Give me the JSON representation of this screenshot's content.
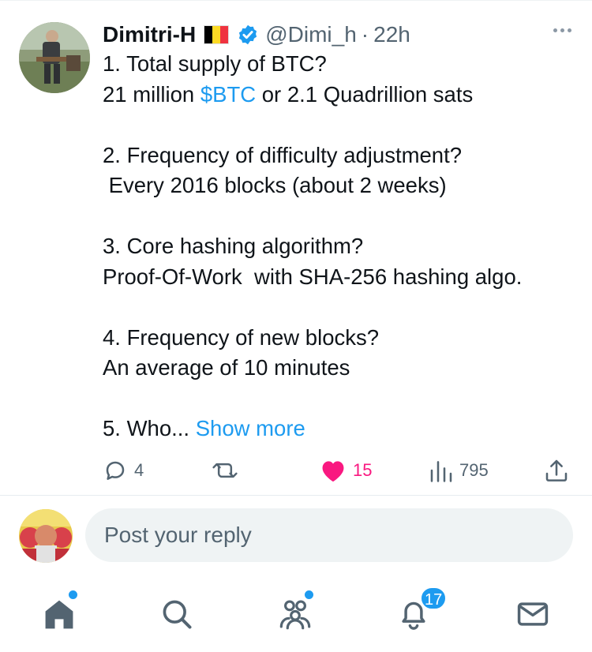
{
  "tweet": {
    "display_name": "Dimitri-H",
    "handle": "@Dimi_h",
    "separator": "·",
    "time": "22h",
    "flag_icon": "belgium-flag",
    "verified_icon": "verified-badge-icon",
    "lines": {
      "q1": "1. Total supply of BTC?",
      "a1_pre": "21 million ",
      "a1_link": "$BTC",
      "a1_post": " or 2.1 Quadrillion sats",
      "q2": "2. Frequency of difficulty adjustment?",
      "a2": " Every 2016 blocks (about 2 weeks)",
      "q3": "3. Core hashing algorithm?",
      "a3": "Proof-Of-Work  with SHA-256 hashing algo.",
      "q4": "4. Frequency of new blocks?",
      "a4": "An average of 10 minutes",
      "q5": "5. Who...",
      "show_more": "Show more"
    },
    "actions": {
      "replies": "4",
      "retweets": "",
      "likes": "15",
      "views": "795"
    }
  },
  "reply": {
    "placeholder": "Post your reply"
  },
  "tabbar": {
    "items": [
      "home-icon",
      "search-icon",
      "communities-icon",
      "notifications-icon",
      "messages-icon"
    ],
    "notifications_badge": "17"
  },
  "colors": {
    "link": "#1d9bf0",
    "like": "#f91880",
    "muted": "#536471"
  }
}
